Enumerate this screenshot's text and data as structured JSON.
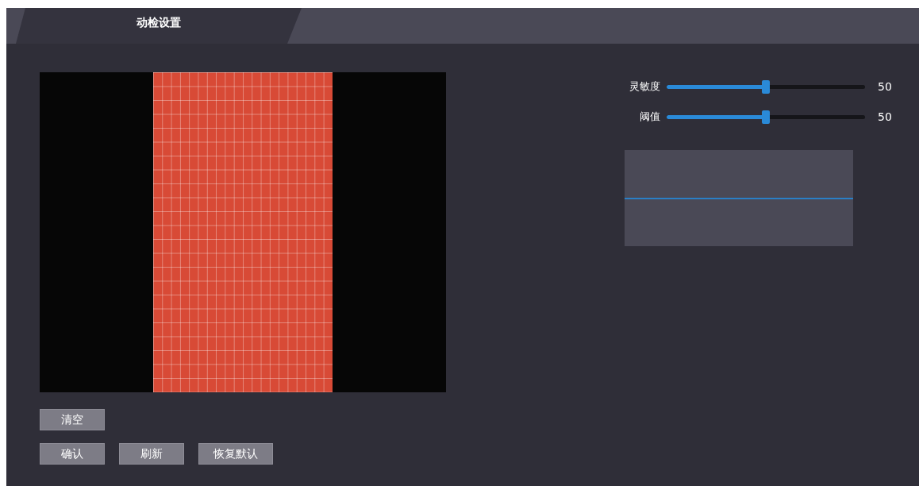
{
  "tabs": [
    {
      "label": "动检设置",
      "selected": true
    }
  ],
  "sliders": [
    {
      "label": "灵敏度",
      "level": 0.5,
      "reading": "50"
    },
    {
      "label": "阈值",
      "level": 0.5,
      "reading": "50"
    }
  ],
  "button_rows": [
    [
      "清空"
    ],
    [
      "确认",
      "刷新",
      "恢复默认"
    ]
  ]
}
